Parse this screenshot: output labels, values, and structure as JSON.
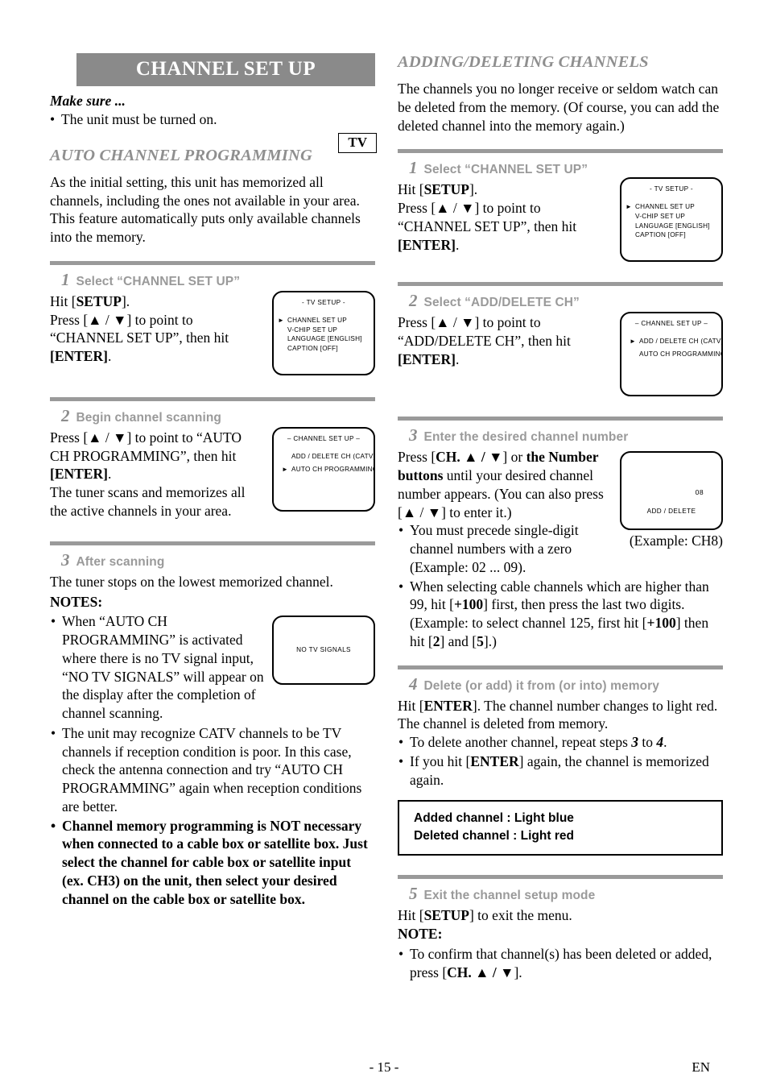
{
  "page": {
    "footer_page_number": "- 15 -",
    "footer_language": "EN"
  },
  "left_column": {
    "banner_title": "CHANNEL SET UP",
    "make_sure_label": "Make sure ...",
    "make_sure_bullet": "The unit must be turned on.",
    "tv_badge": "TV",
    "section_heading": "AUTO CHANNEL PROGRAMMING",
    "intro_paragraph": "As the initial setting, this unit has memorized all channels, including the ones not available in your area. This feature automatically puts only available channels into the memory.",
    "steps": [
      {
        "number": "1",
        "title": "Select “CHANNEL SET UP”",
        "line1_pre": "Hit [",
        "line1_key": "SETUP",
        "line1_post": "].",
        "line2": "Press [▲ / ▼] to point to “CHANNEL SET UP”, then hit [ENTER].",
        "screen": {
          "title": "- TV SETUP -",
          "items": [
            {
              "label": "CHANNEL SET UP",
              "cursor": true
            },
            {
              "label": "V-CHIP SET UP",
              "cursor": false
            },
            {
              "label": "LANGUAGE  [ENGLISH]",
              "cursor": false
            },
            {
              "label": "CAPTION  [OFF]",
              "cursor": false
            }
          ]
        }
      },
      {
        "number": "2",
        "title": "Begin channel scanning",
        "line1": "Press [▲ / ▼] to point to “AUTO CH PROGRAMMING”, then hit [ENTER].",
        "line2": "The tuner scans and memorizes all the active channels in your area.",
        "screen": {
          "title": "– CHANNEL SET UP –",
          "items": [
            {
              "label": "ADD / DELETE CH (CATV)",
              "cursor": false
            },
            {
              "label": "AUTO CH PROGRAMMING",
              "cursor": true
            }
          ]
        }
      },
      {
        "number": "3",
        "title": "After scanning",
        "line1": "The tuner stops on the lowest memorized channel.",
        "notes_label": "NOTES:",
        "notes": [
          "When “AUTO CH PROGRAMMING” is activated where there is no TV signal input, “NO TV SIGNALS” will appear on the display after the completion of channel scanning.",
          "The unit may recognize CATV channels to be TV channels if reception condition is poor. In this case, check the antenna connection and try “AUTO CH PROGRAMMING” again when reception conditions are better.",
          "Channel memory programming is NOT necessary when connected to a cable box or satellite box. Just select the channel for cable box or satellite input (ex. CH3) on the unit, then select your desired channel on the cable box or satellite box."
        ],
        "screen": {
          "message": "NO  TV  SIGNALS"
        }
      }
    ]
  },
  "right_column": {
    "section_heading": "ADDING/DELETING CHANNELS",
    "intro_paragraph": "The channels you no longer receive or seldom watch can be deleted from the memory. (Of course, you can add the deleted channel into the memory again.)",
    "steps": [
      {
        "number": "1",
        "title": "Select “CHANNEL SET UP”",
        "line1": "Hit [SETUP].",
        "line2": "Press [▲ / ▼] to point to “CHANNEL SET UP”, then hit [ENTER].",
        "screen": {
          "title": "- TV SETUP -",
          "items": [
            {
              "label": "CHANNEL SET UP",
              "cursor": true
            },
            {
              "label": "V-CHIP SET UP",
              "cursor": false
            },
            {
              "label": "LANGUAGE  [ENGLISH]",
              "cursor": false
            },
            {
              "label": "CAPTION  [OFF]",
              "cursor": false
            }
          ]
        }
      },
      {
        "number": "2",
        "title": "Select “ADD/DELETE CH”",
        "line1": "Press [▲ / ▼] to point to “ADD/DELETE CH”, then hit [ENTER].",
        "screen": {
          "title": "– CHANNEL SET UP –",
          "items": [
            {
              "label": "ADD / DELETE CH (CATV)",
              "cursor": true
            },
            {
              "label": "AUTO CH PROGRAMMING",
              "cursor": false
            }
          ]
        }
      },
      {
        "number": "3",
        "title": "Enter the desired channel number",
        "line1": "Press [CH. ▲ / ▼] or the Number buttons until your desired channel number appears. (You can also press [▲ / ▼] to enter it.)",
        "notes": [
          "You must precede single-digit channel numbers with a zero (Example: 02 ...  09).",
          "When selecting cable channels which are higher than 99, hit [+100] first, then press the last two digits. (Example: to select channel 125, first hit [+100] then hit [2] and [5].)"
        ],
        "screen": {
          "channel_number": "08",
          "mode_label": "ADD / DELETE"
        },
        "screen_caption": "(Example: CH8)"
      },
      {
        "number": "4",
        "title": "Delete (or add) it from (or into) memory",
        "line1": "Hit [ENTER]. The channel number changes to light red. The channel is deleted from memory.",
        "notes": [
          "To delete another channel, repeat steps 3 to 4.",
          "If you hit [ENTER] again, the channel is memorized again."
        ],
        "emphasis_box": [
          "Added channel   : Light blue",
          "Deleted channel : Light red"
        ]
      },
      {
        "number": "5",
        "title": "Exit the channel setup mode",
        "line1": "Hit [SETUP] to exit the menu.",
        "notes_label": "NOTE:",
        "notes": [
          "To confirm that channel(s) has been deleted or added, press [CH. ▲ / ▼]."
        ]
      }
    ]
  }
}
